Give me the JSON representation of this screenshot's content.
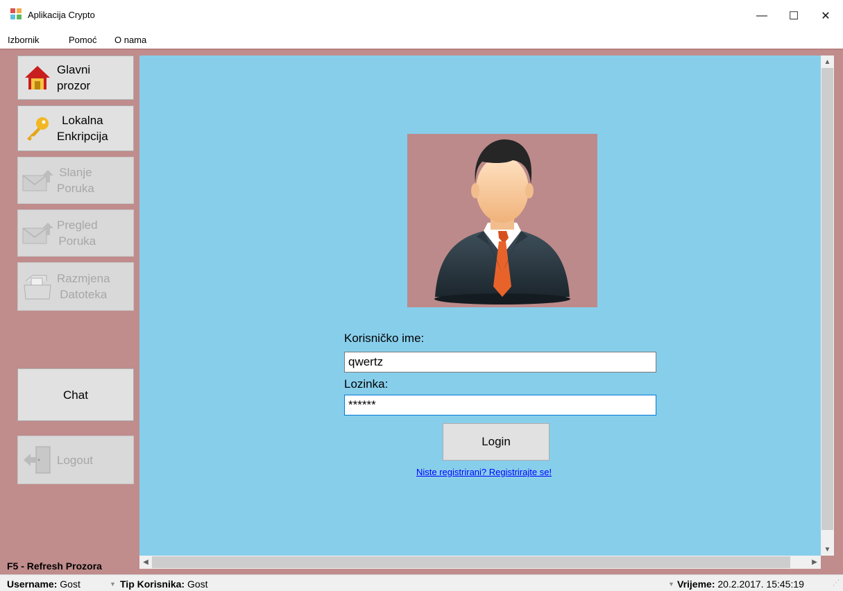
{
  "window": {
    "title": "Aplikacija Crypto",
    "minimize_glyph": "—",
    "maximize_glyph": "☐",
    "close_glyph": "✕"
  },
  "menu": {
    "items": [
      "Izbornik",
      "Pomoć",
      "O nama"
    ]
  },
  "sidebar": {
    "buttons": [
      {
        "label": "Glavni\nprozor",
        "icon": "home-icon",
        "enabled": true
      },
      {
        "label": "Lokalna\nEnkripcija",
        "icon": "key-icon",
        "enabled": true
      },
      {
        "label": "Slanje\nPoruka",
        "icon": "send-mail-icon",
        "enabled": false
      },
      {
        "label": "Pregled\nPoruka",
        "icon": "view-mail-icon",
        "enabled": false
      },
      {
        "label": "Razmjena\nDatoteka",
        "icon": "file-exchange-icon",
        "enabled": false
      },
      {
        "label": "Chat",
        "icon": "",
        "enabled": true
      },
      {
        "label": "Logout",
        "icon": "logout-door-icon",
        "enabled": false
      }
    ],
    "refresh_hint": "F5 - Refresh Prozora"
  },
  "login": {
    "avatar_icon": "user-avatar-icon",
    "username_label": "Korisničko ime:",
    "username_value": "qwertz",
    "password_label": "Lozinka:",
    "password_value": "******",
    "login_button": "Login",
    "register_link": "Niste registrirani? Registrirajte se!"
  },
  "statusbar": {
    "username_label": "Username:",
    "username_value": "Gost",
    "type_label": "Tip Korisnika:",
    "type_value": "Gost",
    "time_label": "Vrijeme:",
    "time_value": "20.2.2017. 15:45:19"
  },
  "colors": {
    "sidebar_bg": "#c08c8c",
    "content_bg": "#87ceeb",
    "avatar_bg": "#bc8a8a",
    "link": "#0000ff"
  }
}
